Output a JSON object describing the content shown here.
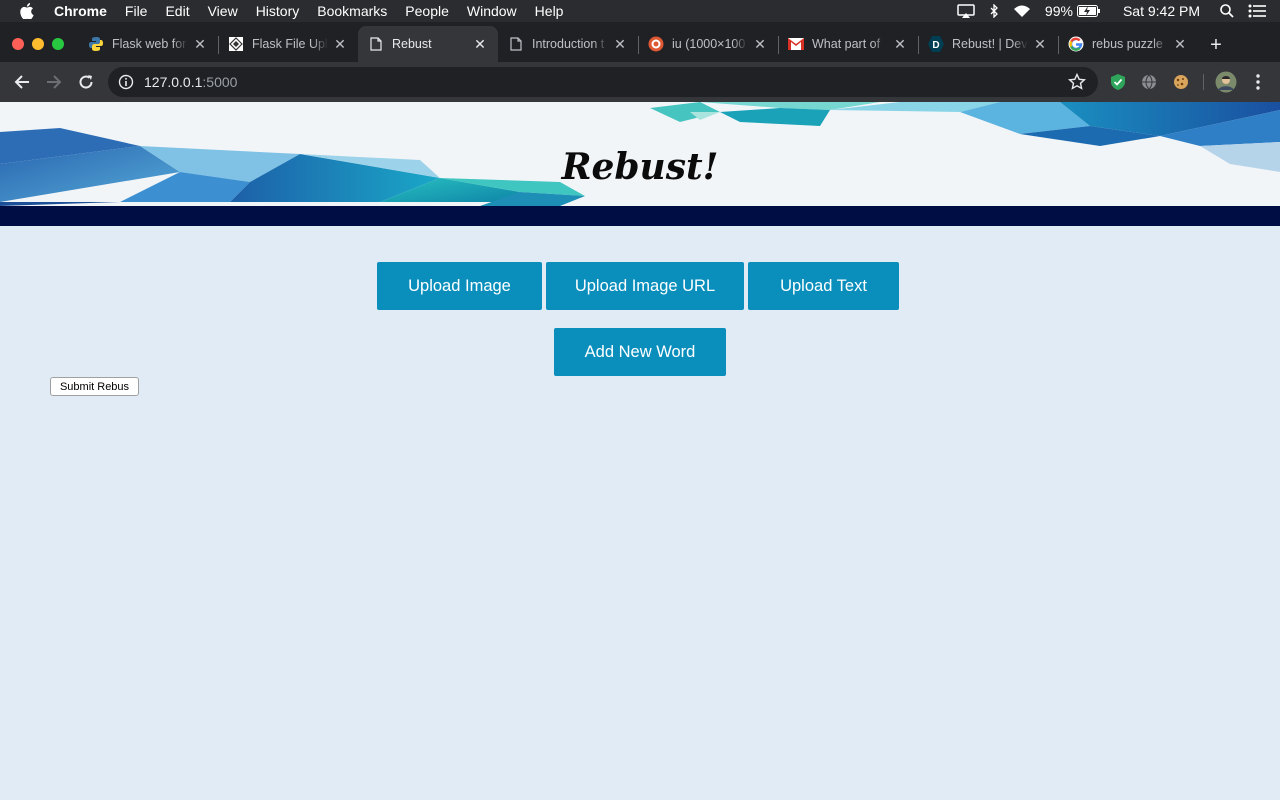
{
  "menubar": {
    "app": "Chrome",
    "items": [
      "File",
      "Edit",
      "View",
      "History",
      "Bookmarks",
      "People",
      "Window",
      "Help"
    ],
    "battery": "99%",
    "clock": "Sat 9:42 PM"
  },
  "tabs": [
    {
      "title": "Flask web for",
      "icon": "python-icon"
    },
    {
      "title": "Flask File Upl",
      "icon": "flask-upload-icon"
    },
    {
      "title": "Rebust",
      "icon": "document-icon",
      "active": true
    },
    {
      "title": "Introduction t",
      "icon": "document-icon"
    },
    {
      "title": "iu (1000×100",
      "icon": "duckduckgo-icon"
    },
    {
      "title": "What part of",
      "icon": "gmail-icon"
    },
    {
      "title": "Rebust! | Dev",
      "icon": "devpost-icon"
    },
    {
      "title": "rebus puzzle",
      "icon": "google-icon"
    }
  ],
  "address": {
    "host": "127.0.0.1",
    "port": ":5000"
  },
  "page": {
    "title": "Rebust!",
    "buttons": {
      "upload_image": "Upload Image",
      "upload_image_url": "Upload Image URL",
      "upload_text": "Upload Text",
      "add_new_word": "Add New Word"
    },
    "submit": "Submit Rebus"
  },
  "colors": {
    "button": "#0a8fbd",
    "navbar": "#000c44",
    "page_bg": "#e1ebf5"
  }
}
